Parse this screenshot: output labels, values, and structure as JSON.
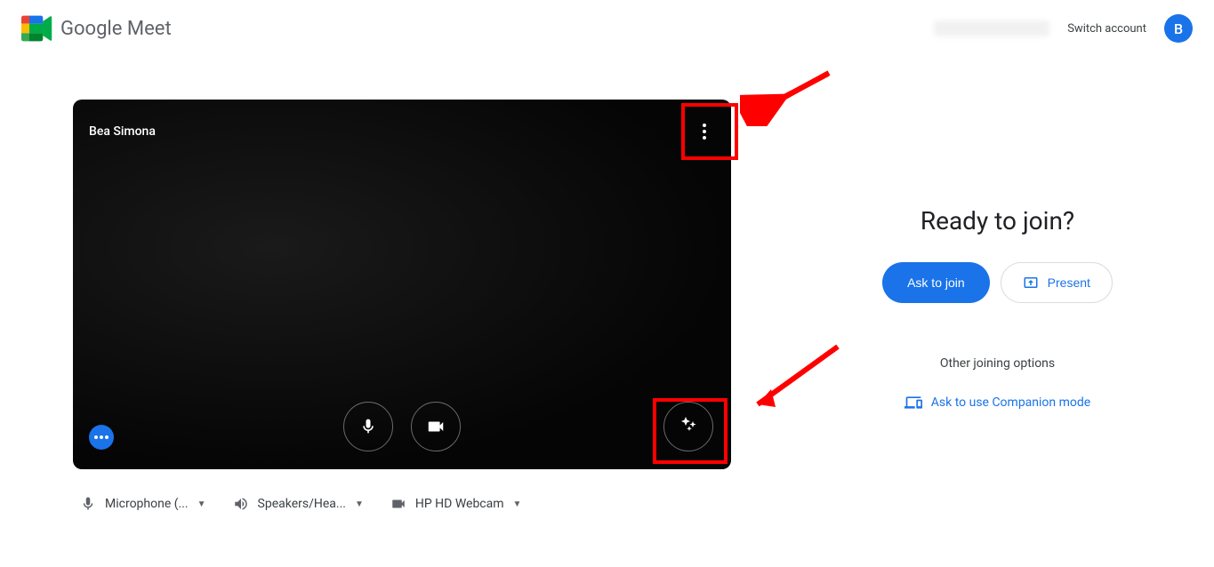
{
  "header": {
    "product_name_1": "Google",
    "product_name_2": "Meet",
    "switch_account": "Switch account",
    "avatar_letter": "B"
  },
  "video": {
    "participant_name": "Bea Simona"
  },
  "devices": {
    "mic_label": "Microphone (...",
    "speaker_label": "Speakers/Hea...",
    "camera_label": "HP HD Webcam"
  },
  "join": {
    "title": "Ready to join?",
    "ask_button": "Ask to join",
    "present_button": "Present",
    "options_label": "Other joining options",
    "companion_link": "Ask to use Companion mode"
  }
}
